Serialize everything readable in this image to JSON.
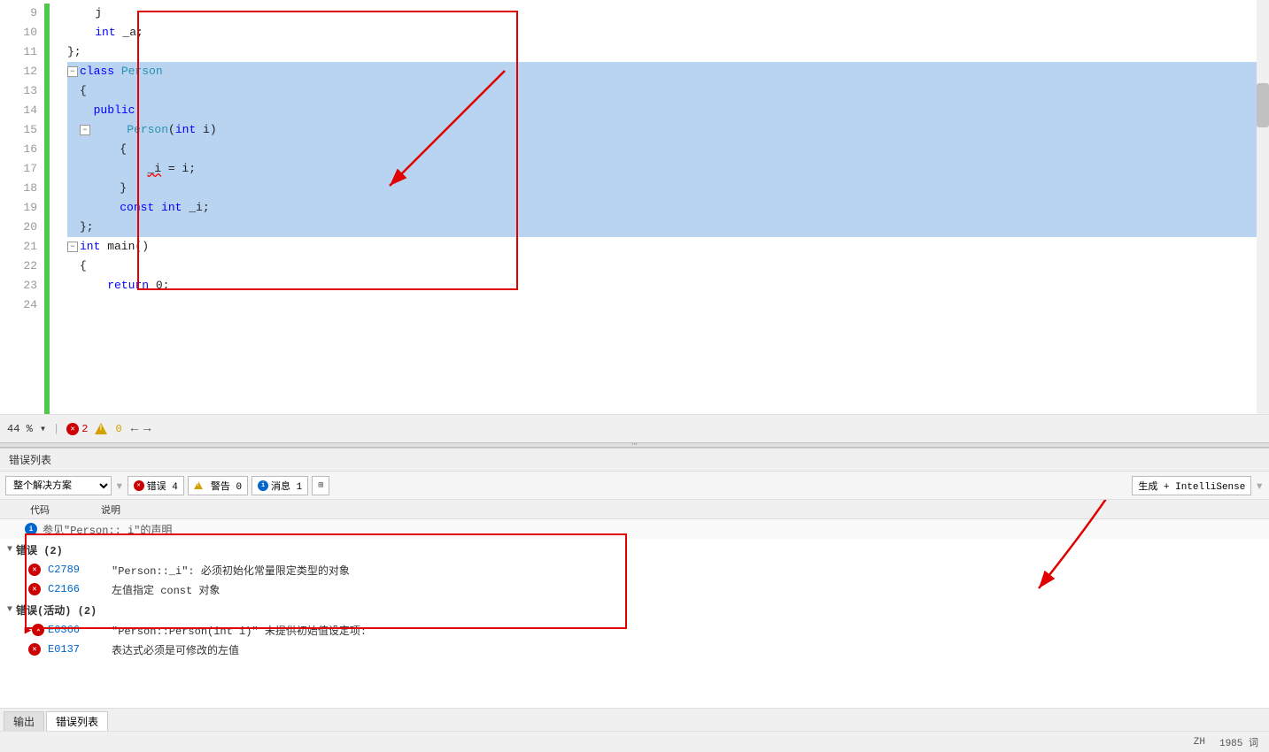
{
  "editor": {
    "lines": [
      {
        "num": "9",
        "code": "    j",
        "selected": false,
        "indent": 0
      },
      {
        "num": "10",
        "code": "    int _a;",
        "selected": false,
        "indent": 0
      },
      {
        "num": "11",
        "code": "};",
        "selected": false,
        "indent": 0
      },
      {
        "num": "12",
        "code": "class Person",
        "selected": true,
        "hasFold": true,
        "indent": 0
      },
      {
        "num": "13",
        "code": "{",
        "selected": true,
        "indent": 0
      },
      {
        "num": "14",
        "code": "  public:",
        "selected": true,
        "indent": 0
      },
      {
        "num": "15",
        "code": "    Person(int i)",
        "selected": true,
        "hasFold": true,
        "indent": 1
      },
      {
        "num": "16",
        "code": "    {",
        "selected": true,
        "indent": 1
      },
      {
        "num": "17",
        "code": "        _i = i;",
        "selected": true,
        "indent": 2
      },
      {
        "num": "18",
        "code": "    }",
        "selected": true,
        "indent": 1
      },
      {
        "num": "19",
        "code": "    const int _i;",
        "selected": true,
        "indent": 1
      },
      {
        "num": "20",
        "code": "};",
        "selected": true,
        "indent": 0
      },
      {
        "num": "21",
        "code": "int main()",
        "selected": false,
        "hasFold": true,
        "indent": 0
      },
      {
        "num": "22",
        "code": "{",
        "selected": false,
        "indent": 0
      },
      {
        "num": "23",
        "code": "    return 0;",
        "selected": false,
        "indent": 0
      },
      {
        "num": "24",
        "code": "",
        "selected": false,
        "indent": 0
      }
    ],
    "zoom": "44 %",
    "error_count": "2",
    "warn_count": "0"
  },
  "status_bar": {
    "zoom": "44 %",
    "errors": "2",
    "warnings": "0",
    "nav_prev": "←",
    "nav_next": "→"
  },
  "error_panel": {
    "title": "错误列表",
    "scope_label": "整个解决方案",
    "btn_errors": "错误 4",
    "btn_warnings": "警告 0",
    "btn_messages": "消息 1",
    "btn_build": "生成 + IntelliSense",
    "col_code": "代码",
    "col_desc": "说明",
    "hint_row": "参见\"Person::_i\"的声明",
    "groups": [
      {
        "label": "错误 (2)",
        "items": [
          {
            "code": "C2789",
            "desc": "\"Person::_i\": 必须初始化常量限定类型的对象",
            "icon": "error"
          },
          {
            "code": "C2166",
            "desc": "左值指定 const 对象",
            "icon": "error"
          }
        ]
      },
      {
        "label": "错误(活动) (2)",
        "items": [
          {
            "code": "E0366",
            "desc": "\"Person::Person(int i)\" 未提供初始值设定项:",
            "icon": "warning"
          },
          {
            "code": "E0137",
            "desc": "表达式必须是可修改的左值",
            "icon": "warning"
          }
        ]
      }
    ]
  },
  "bottom_tabs": [
    {
      "label": "输出",
      "active": false
    },
    {
      "label": "错误列表",
      "active": true
    }
  ],
  "status_info": {
    "lang": "ZH",
    "words": "1985 词"
  }
}
